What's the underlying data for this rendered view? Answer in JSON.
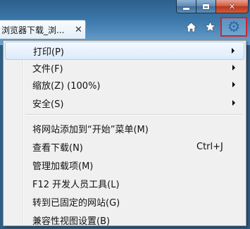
{
  "tab": {
    "title": "浏览器下载_浏...",
    "close_glyph": "✕"
  },
  "toolbar": {
    "home_icon": "home-icon",
    "favorites_icon": "star-icon",
    "tools_icon": "gear-icon",
    "highlight_color": "#d0252a"
  },
  "menu": {
    "items": [
      {
        "label": "打印(P)",
        "shortcut": "",
        "has_submenu": true
      },
      {
        "label": "文件(F)",
        "shortcut": "",
        "has_submenu": true
      },
      {
        "label": "缩放(Z) (100%)",
        "shortcut": "",
        "has_submenu": true
      },
      {
        "label": "安全(S)",
        "shortcut": "",
        "has_submenu": true
      },
      {
        "label": "将网站添加到“开始”菜单(M)",
        "shortcut": "",
        "has_submenu": false
      },
      {
        "label": "查看下载(N)",
        "shortcut": "Ctrl+J",
        "has_submenu": false
      },
      {
        "label": "管理加载项(M)",
        "shortcut": "",
        "has_submenu": false
      },
      {
        "label": "F12 开发人员工具(L)",
        "shortcut": "",
        "has_submenu": false
      },
      {
        "label": "转到已固定的网站(G)",
        "shortcut": "",
        "has_submenu": false
      },
      {
        "label": "兼容性视图设置(B)",
        "shortcut": "",
        "has_submenu": false
      }
    ]
  }
}
